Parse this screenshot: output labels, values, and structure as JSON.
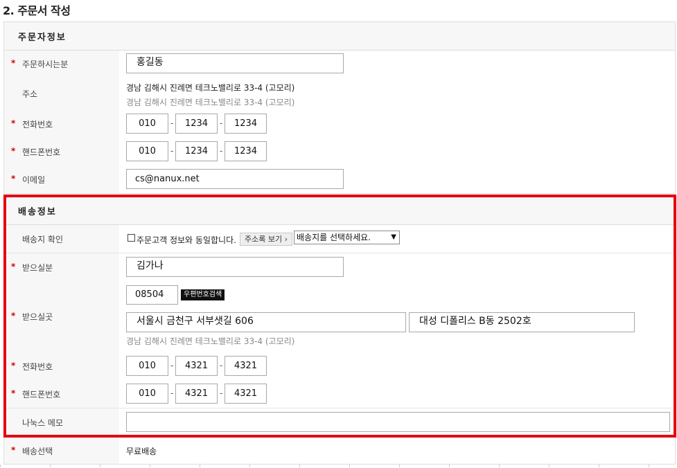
{
  "page_title": "2. 주문서 작성",
  "orderer": {
    "header": "주문자정보",
    "name_label": "주문하시는분",
    "name_value": "홍길동",
    "address_label": "주소",
    "address_line1": "경남 김해시 진례면 테크노밸리로 33-4 (고모리)",
    "address_line2": "경남 김해시 진례면 테크노밸리로 33-4 (고모리)",
    "phone_label": "전화번호",
    "phone": [
      "010",
      "1234",
      "1234"
    ],
    "mobile_label": "핸드폰번호",
    "mobile": [
      "010",
      "1234",
      "1234"
    ],
    "email_label": "이메일",
    "email_value": "cs@nanux.net",
    "required_mark": "*"
  },
  "shipping": {
    "header": "배송정보",
    "confirm_label": "배송지 확인",
    "same_as_orderer_label": "주문고객 정보와 동일합니다.",
    "address_book_button": "주소록 보기 ›",
    "select_value": "배송지를 선택하세요.",
    "select_arrow": "▼",
    "recipient_label": "받으실분",
    "recipient_value": "김가나",
    "zipcode_value": "08504",
    "zipcode_button": "우편번호검색",
    "place_label": "받으실곳",
    "address1_value": "서울시 금천구 서부샛길 606",
    "address2_value": "대성 디폴리스 B동 2502호",
    "address_hint": "경남 김해시 진례면 테크노밸리로 33-4 (고모리)",
    "phone_label": "전화번호",
    "phone": [
      "010",
      "4321",
      "4321"
    ],
    "mobile_label": "핸드폰번호",
    "mobile": [
      "010",
      "4321",
      "4321"
    ],
    "memo_label": "나눅스 메모",
    "memo_value": "",
    "delivery_label": "배송선택",
    "delivery_value": "무료배송",
    "highlight_color": "#e4000f"
  },
  "dash": "-"
}
